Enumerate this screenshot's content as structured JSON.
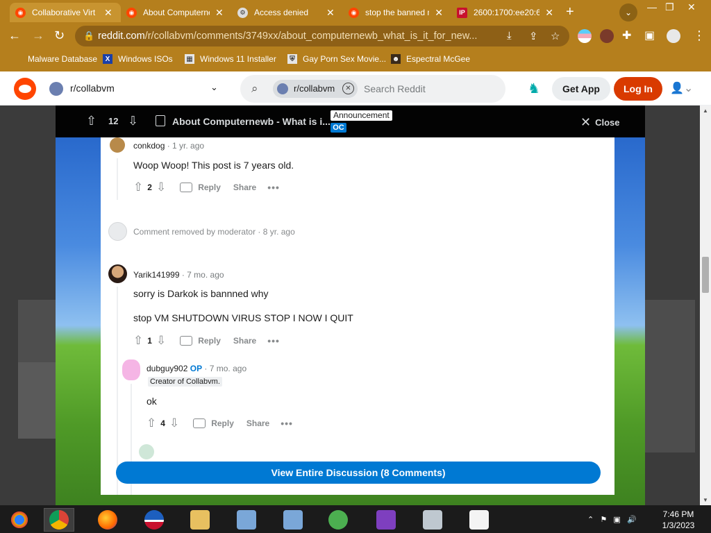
{
  "browser": {
    "tabs": [
      {
        "title": "Collaborative Virt",
        "active": true
      },
      {
        "title": "About Computerne",
        "active": false
      },
      {
        "title": "Access denied",
        "active": false
      },
      {
        "title": "stop the banned m",
        "active": false
      },
      {
        "title": "2600:1700:ee20:6",
        "active": false
      }
    ],
    "new_tab_label": "+",
    "address": {
      "host": "reddit.com",
      "path": "/r/collabvm/comments/3749xx/about_computernewb_what_is_it_for_new..."
    },
    "bookmarks": [
      "Malware Database",
      "Windows ISOs",
      "Windows 11 Installer",
      "Gay Porn Sex Movie...",
      "Espectral McGee"
    ]
  },
  "reddit_header": {
    "subreddit": "r/collabvm",
    "search_chip": "r/collabvm",
    "search_placeholder": "Search Reddit",
    "get_app": "Get App",
    "login": "Log In"
  },
  "post_bar": {
    "score": "12",
    "title": "About Computernewb - What is i...",
    "flair_announcement": "Announcement",
    "flair_oc": "OC",
    "close_label": "Close"
  },
  "comments": [
    {
      "author": "conkdog",
      "meta": "· 1 yr. ago",
      "body": "Woop Woop! This post is 7 years old.",
      "score": "2"
    },
    {
      "removed_text": "Comment removed by moderator",
      "meta": "· 8 yr. ago"
    },
    {
      "author": "Yarik141999",
      "meta": "· 7 mo. ago",
      "body": "sorry is Darkok is bannned why",
      "body2": "stop VM SHUTDOWN VIRUS STOP I NOW I QUIT",
      "score": "1"
    },
    {
      "author": "dubguy902",
      "op": "OP",
      "meta": "· 7 mo. ago",
      "flair": "Creator of Collabvm.",
      "body": "ok",
      "score": "4"
    }
  ],
  "actions": {
    "reply": "Reply",
    "share": "Share",
    "more": "•••"
  },
  "view_all": "View Entire Discussion (8 Comments)",
  "taskbar": {
    "time": "7:46 PM",
    "date": "1/3/2023"
  },
  "colors": {
    "accent": "#0079d3",
    "brand": "#ff4500",
    "chrome": "#b57f1d"
  }
}
